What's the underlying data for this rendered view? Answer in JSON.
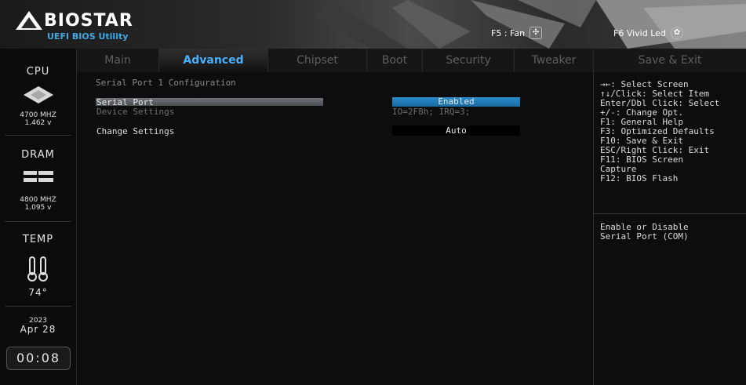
{
  "brand": {
    "name": "BIOSTAR",
    "subtitle": "UEFI BIOS Utility",
    "accent": "#3fa9e6"
  },
  "header": {
    "fan": {
      "label": "F5 : Fan",
      "icon": "fan-icon"
    },
    "vivid": {
      "label": "F6  Vivid Led",
      "icon": "led-icon"
    }
  },
  "sidebar": {
    "cpu": {
      "title": "CPU",
      "freq": "4700 MHZ",
      "volt": "1.462 v"
    },
    "dram": {
      "title": "DRAM",
      "freq": "4800 MHZ",
      "volt": "1.095 v"
    },
    "temp": {
      "title": "TEMP",
      "value": "74°"
    },
    "date": {
      "year": "2023",
      "day": "Apr 28"
    },
    "time": "00:08"
  },
  "tabs": [
    {
      "label": "Main"
    },
    {
      "label": "Advanced",
      "active": true
    },
    {
      "label": "Chipset"
    },
    {
      "label": "Boot"
    },
    {
      "label": "Security"
    },
    {
      "label": "Tweaker"
    },
    {
      "label": "Save & Exit"
    }
  ],
  "page": {
    "title": "Serial Port 1 Configuration",
    "serial_port": {
      "label": "Serial Port",
      "value": "Enabled"
    },
    "device_settings": {
      "label": "Device Settings",
      "value": "IO=2F8h; IRQ=3;"
    },
    "change_settings": {
      "label": "Change Settings",
      "value": "Auto"
    }
  },
  "help": {
    "keys": [
      "→←: Select Screen",
      "↑↓/Click: Select Item",
      "Enter/Dbl Click: Select",
      "+/-: Change Opt.",
      "F1: General Help",
      "F3: Optimized Defaults",
      "F10: Save & Exit",
      "ESC/Right Click: Exit",
      "F11: BIOS Screen",
      "Capture",
      "F12: BIOS Flash"
    ],
    "description": [
      "Enable or Disable",
      "Serial Port (COM)"
    ]
  },
  "colors": {
    "tab_active": "#4ab0ff",
    "selected_value_bg": "#1f7fb8"
  }
}
